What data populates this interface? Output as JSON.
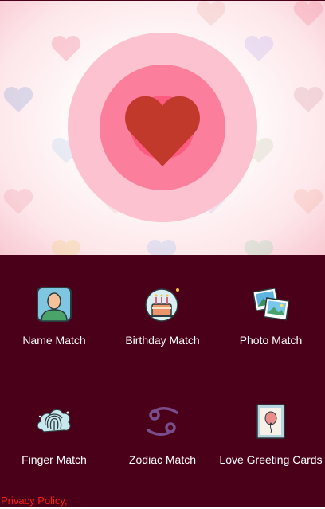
{
  "hero": {
    "accent_colors": {
      "outer_ring": "#fcc2cf",
      "middle_ring": "#fb7e9c",
      "inner_ring": "#fd5a80",
      "heart": "#c0392b"
    },
    "main_icon": "heart-icon"
  },
  "menu": {
    "background": "#4a0019",
    "items": [
      {
        "label": "Name Match",
        "icon": "person-portrait-icon"
      },
      {
        "label": "Birthday Match",
        "icon": "birthday-cake-icon"
      },
      {
        "label": "Photo Match",
        "icon": "photos-icon"
      },
      {
        "label": "Finger Match",
        "icon": "fingerprint-icon"
      },
      {
        "label": "Zodiac Match",
        "icon": "cancer-zodiac-icon"
      },
      {
        "label": "Love Greeting Cards",
        "icon": "greeting-card-icon"
      }
    ]
  },
  "footer": {
    "privacy_label": "Privacy Policy,",
    "privacy_color": "#ff1a1a"
  }
}
